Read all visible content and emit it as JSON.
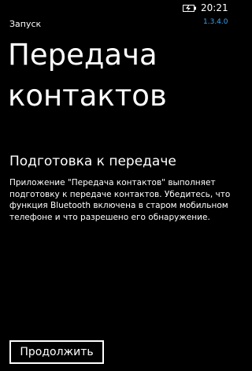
{
  "status_bar": {
    "battery_icon": "battery-charging-icon",
    "time": "20:21",
    "version": "1.3.4.0",
    "version_color": "#3aa3f0"
  },
  "header": {
    "app_label": "Запуск",
    "title": "Передача контактов"
  },
  "main": {
    "section_title": "Подготовка к передаче",
    "description": "Приложение \"Передача контактов\" выполняет подготовку к передаче контактов. Убедитесь, что функция Bluetooth включена в старом мобильном телефоне и что разрешено его обнаружение."
  },
  "actions": {
    "continue_label": "Продолжить"
  }
}
